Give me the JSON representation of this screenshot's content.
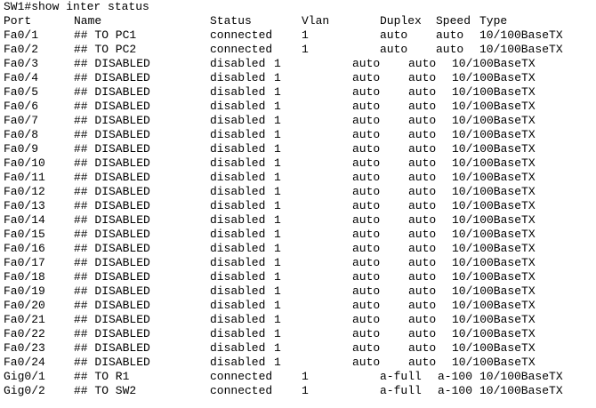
{
  "terminal": {
    "prompt_line": "SW1#show inter status",
    "headers": {
      "port": "Port",
      "name": "Name",
      "status": "Status",
      "vlan": "Vlan",
      "duplex": "Duplex",
      "speed": "Speed",
      "type": "Type"
    },
    "rows": [
      {
        "port": "Fa0/1",
        "name": "## TO PC1",
        "status": "connected",
        "vlan": "1",
        "duplex": "auto",
        "speed": "auto",
        "type": "10/100BaseTX",
        "kind": "connected"
      },
      {
        "port": "Fa0/2",
        "name": "## TO PC2",
        "status": "connected",
        "vlan": "1",
        "duplex": "auto",
        "speed": "auto",
        "type": "10/100BaseTX",
        "kind": "connected"
      },
      {
        "port": "Fa0/3",
        "name": "## DISABLED",
        "status": "disabled",
        "vlan": "1",
        "duplex": "auto",
        "speed": "auto",
        "type": "10/100BaseTX",
        "kind": "disabled"
      },
      {
        "port": "Fa0/4",
        "name": "## DISABLED",
        "status": "disabled",
        "vlan": "1",
        "duplex": "auto",
        "speed": "auto",
        "type": "10/100BaseTX",
        "kind": "disabled"
      },
      {
        "port": "Fa0/5",
        "name": "## DISABLED",
        "status": "disabled",
        "vlan": "1",
        "duplex": "auto",
        "speed": "auto",
        "type": "10/100BaseTX",
        "kind": "disabled"
      },
      {
        "port": "Fa0/6",
        "name": "## DISABLED",
        "status": "disabled",
        "vlan": "1",
        "duplex": "auto",
        "speed": "auto",
        "type": "10/100BaseTX",
        "kind": "disabled"
      },
      {
        "port": "Fa0/7",
        "name": "## DISABLED",
        "status": "disabled",
        "vlan": "1",
        "duplex": "auto",
        "speed": "auto",
        "type": "10/100BaseTX",
        "kind": "disabled"
      },
      {
        "port": "Fa0/8",
        "name": "## DISABLED",
        "status": "disabled",
        "vlan": "1",
        "duplex": "auto",
        "speed": "auto",
        "type": "10/100BaseTX",
        "kind": "disabled"
      },
      {
        "port": "Fa0/9",
        "name": "## DISABLED",
        "status": "disabled",
        "vlan": "1",
        "duplex": "auto",
        "speed": "auto",
        "type": "10/100BaseTX",
        "kind": "disabled"
      },
      {
        "port": "Fa0/10",
        "name": "## DISABLED",
        "status": "disabled",
        "vlan": "1",
        "duplex": "auto",
        "speed": "auto",
        "type": "10/100BaseTX",
        "kind": "disabled"
      },
      {
        "port": "Fa0/11",
        "name": "## DISABLED",
        "status": "disabled",
        "vlan": "1",
        "duplex": "auto",
        "speed": "auto",
        "type": "10/100BaseTX",
        "kind": "disabled"
      },
      {
        "port": "Fa0/12",
        "name": "## DISABLED",
        "status": "disabled",
        "vlan": "1",
        "duplex": "auto",
        "speed": "auto",
        "type": "10/100BaseTX",
        "kind": "disabled"
      },
      {
        "port": "Fa0/13",
        "name": "## DISABLED",
        "status": "disabled",
        "vlan": "1",
        "duplex": "auto",
        "speed": "auto",
        "type": "10/100BaseTX",
        "kind": "disabled"
      },
      {
        "port": "Fa0/14",
        "name": "## DISABLED",
        "status": "disabled",
        "vlan": "1",
        "duplex": "auto",
        "speed": "auto",
        "type": "10/100BaseTX",
        "kind": "disabled"
      },
      {
        "port": "Fa0/15",
        "name": "## DISABLED",
        "status": "disabled",
        "vlan": "1",
        "duplex": "auto",
        "speed": "auto",
        "type": "10/100BaseTX",
        "kind": "disabled"
      },
      {
        "port": "Fa0/16",
        "name": "## DISABLED",
        "status": "disabled",
        "vlan": "1",
        "duplex": "auto",
        "speed": "auto",
        "type": "10/100BaseTX",
        "kind": "disabled"
      },
      {
        "port": "Fa0/17",
        "name": "## DISABLED",
        "status": "disabled",
        "vlan": "1",
        "duplex": "auto",
        "speed": "auto",
        "type": "10/100BaseTX",
        "kind": "disabled"
      },
      {
        "port": "Fa0/18",
        "name": "## DISABLED",
        "status": "disabled",
        "vlan": "1",
        "duplex": "auto",
        "speed": "auto",
        "type": "10/100BaseTX",
        "kind": "disabled"
      },
      {
        "port": "Fa0/19",
        "name": "## DISABLED",
        "status": "disabled",
        "vlan": "1",
        "duplex": "auto",
        "speed": "auto",
        "type": "10/100BaseTX",
        "kind": "disabled"
      },
      {
        "port": "Fa0/20",
        "name": "## DISABLED",
        "status": "disabled",
        "vlan": "1",
        "duplex": "auto",
        "speed": "auto",
        "type": "10/100BaseTX",
        "kind": "disabled"
      },
      {
        "port": "Fa0/21",
        "name": "## DISABLED",
        "status": "disabled",
        "vlan": "1",
        "duplex": "auto",
        "speed": "auto",
        "type": "10/100BaseTX",
        "kind": "disabled"
      },
      {
        "port": "Fa0/22",
        "name": "## DISABLED",
        "status": "disabled",
        "vlan": "1",
        "duplex": "auto",
        "speed": "auto",
        "type": "10/100BaseTX",
        "kind": "disabled"
      },
      {
        "port": "Fa0/23",
        "name": "## DISABLED",
        "status": "disabled",
        "vlan": "1",
        "duplex": "auto",
        "speed": "auto",
        "type": "10/100BaseTX",
        "kind": "disabled"
      },
      {
        "port": "Fa0/24",
        "name": "## DISABLED",
        "status": "disabled",
        "vlan": "1",
        "duplex": "auto",
        "speed": "auto",
        "type": "10/100BaseTX",
        "kind": "disabled"
      },
      {
        "port": "Gig0/1",
        "name": "## TO R1",
        "status": "connected",
        "vlan": "1",
        "duplex": "a-full",
        "speed": "a-100",
        "type": "10/100BaseTX",
        "kind": "gig"
      },
      {
        "port": "Gig0/2",
        "name": "## TO SW2",
        "status": "connected",
        "vlan": "1",
        "duplex": "a-full",
        "speed": "a-100",
        "type": "10/100BaseTX",
        "kind": "gig"
      }
    ]
  }
}
